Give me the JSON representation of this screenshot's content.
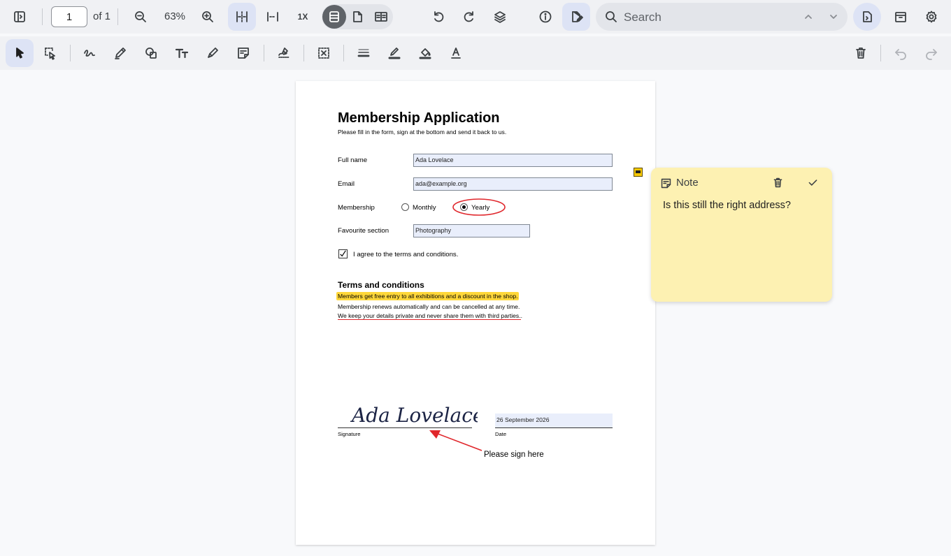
{
  "toolbar": {
    "page_number": "1",
    "page_count": "of 1",
    "zoom": "63%",
    "zoom_1x": "1X",
    "search_placeholder": "Search"
  },
  "document": {
    "title": "Membership Application",
    "subtitle": "Please fill in the form, sign at the bottom and send it back to us.",
    "full_name_label": "Full name",
    "full_name_value": "Ada Lovelace",
    "email_label": "Email",
    "email_value": "ada@example.org",
    "membership_label": "Membership",
    "option_monthly": "Monthly",
    "option_yearly": "Yearly",
    "favourite_label": "Favourite section",
    "favourite_value": "Photography",
    "agree_text": "I agree to the terms and conditions.",
    "terms_heading": "Terms and conditions",
    "terms_line1": "Members get free entry to all exhibitions and a discount in the shop.",
    "terms_line2": "Membership renews automatically and can be cancelled at any time.",
    "terms_line3": "We keep your details private and never share them with third parties.",
    "terms_line3_end": ".",
    "signature": "Ada Lovelace",
    "signature_label": "Signature",
    "date_value": "26 September 2026",
    "date_label": "Date",
    "callout": "Please sign here"
  },
  "note": {
    "title": "Note",
    "body": "Is this still the right address?"
  },
  "colors": {
    "accent_bg": "#dde3f5",
    "highlight": "#ffd73a",
    "annotation_red": "#e0262b",
    "note_bg": "#fdf1b2",
    "signature_ink": "#1c2445"
  }
}
